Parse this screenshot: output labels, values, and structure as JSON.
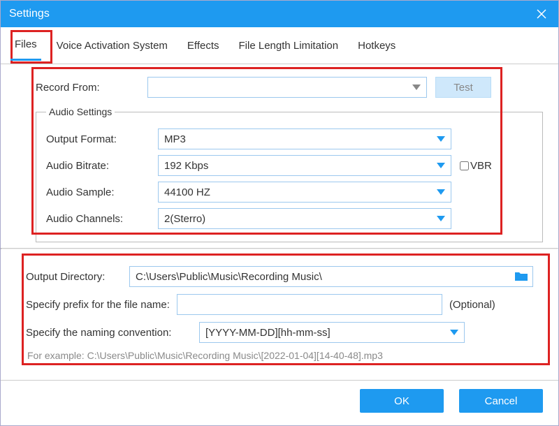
{
  "title": "Settings",
  "tabs": [
    "Files",
    "Voice Activation System",
    "Effects",
    "File Length Limitation",
    "Hotkeys"
  ],
  "record_from_label": "Record  From:",
  "record_from_value": "",
  "test_label": "Test",
  "audio_group": "Audio Settings",
  "audio": {
    "output_format_label": "Output Format:",
    "output_format_value": "MP3",
    "bitrate_label": "Audio Bitrate:",
    "bitrate_value": "192 Kbps",
    "vbr_label": "VBR",
    "sample_label": "Audio Sample:",
    "sample_value": "44100 HZ",
    "channels_label": "Audio Channels:",
    "channels_value": "2(Sterro)"
  },
  "output_dir_label": "Output Directory:",
  "output_dir_value": "C:\\Users\\Public\\Music\\Recording Music\\",
  "prefix_label": "Specify prefix for the file name:",
  "prefix_value": "",
  "optional_text": "(Optional)",
  "naming_label": "Specify the naming convention:",
  "naming_value": "[YYYY-MM-DD][hh-mm-ss]",
  "example_text": "For example: C:\\Users\\Public\\Music\\Recording Music\\[2022-01-04][14-40-48].mp3",
  "ok_label": "OK",
  "cancel_label": "Cancel"
}
